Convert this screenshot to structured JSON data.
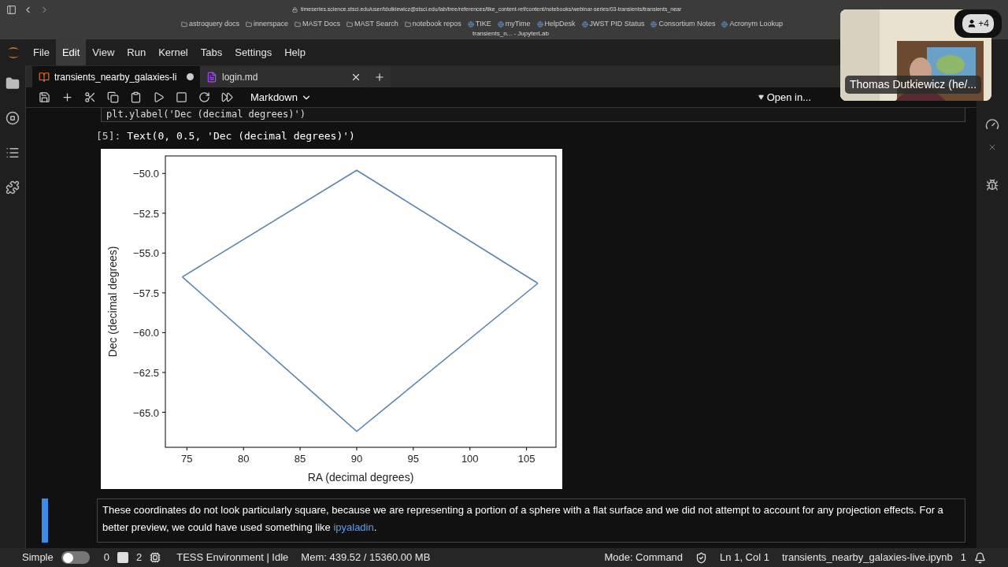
{
  "browser": {
    "url": "timeseries.science.stsci.edu/user/tdutkiewicz@stsci.edu/lab/tree/references/tike_content-ref/content/notebooks/webinar-series/03-transients/transients_near",
    "page_tab": "transients_n... - JupyterLab",
    "bookmarks": [
      {
        "label": "astroquery docs",
        "kind": "folder"
      },
      {
        "label": "innerspace",
        "kind": "folder"
      },
      {
        "label": "MAST Docs",
        "kind": "folder"
      },
      {
        "label": "MAST Search",
        "kind": "folder"
      },
      {
        "label": "notebook repos",
        "kind": "folder"
      },
      {
        "label": "TIKE",
        "kind": "site"
      },
      {
        "label": "myTime",
        "kind": "site"
      },
      {
        "label": "HelpDesk",
        "kind": "site"
      },
      {
        "label": "JWST PID Status",
        "kind": "site"
      },
      {
        "label": "Consortium Notes",
        "kind": "site"
      },
      {
        "label": "Acronym Lookup",
        "kind": "site"
      }
    ]
  },
  "menu": [
    {
      "label": "File",
      "selected": false
    },
    {
      "label": "Edit",
      "selected": true
    },
    {
      "label": "View",
      "selected": false
    },
    {
      "label": "Run",
      "selected": false
    },
    {
      "label": "Kernel",
      "selected": false
    },
    {
      "label": "Tabs",
      "selected": false
    },
    {
      "label": "Settings",
      "selected": false
    },
    {
      "label": "Help",
      "selected": false
    }
  ],
  "tabs": [
    {
      "label": "transients_nearby_galaxies-li",
      "kind": "notebook",
      "selected": true,
      "dirty": true
    },
    {
      "label": "login.md",
      "kind": "markdown",
      "selected": false,
      "dirty": false
    }
  ],
  "toolbar": {
    "cell_type": "Markdown",
    "open_in": "Open in..."
  },
  "code_tail": "plt.ylabel('Dec (decimal degrees)')",
  "output": {
    "prompt": "[5]:",
    "text": "Text(0, 0.5, 'Dec (decimal degrees)')",
    "chart_data": {
      "type": "line",
      "xlabel": "RA (decimal degrees)",
      "ylabel": "Dec (decimal degrees)",
      "x": [
        74.6,
        90,
        106
      ],
      "series": [
        {
          "color": "#5b84ad",
          "values": [
            -56.5,
            -49.8,
            -56.9
          ]
        },
        {
          "color": "#5b84ad",
          "values": [
            -56.5,
            -66.2,
            -56.9
          ]
        }
      ],
      "xlim": [
        73.1,
        107.6
      ],
      "ylim": [
        -67.2,
        -48.9
      ],
      "xticks": [
        75,
        80,
        85,
        90,
        95,
        100,
        105
      ],
      "yticks": [
        {
          "value": -50,
          "label": "−50.0"
        },
        {
          "value": -52.5,
          "label": "−52.5"
        },
        {
          "value": -55,
          "label": "−55.0"
        },
        {
          "value": -57.5,
          "label": "−57.5"
        },
        {
          "value": -60,
          "label": "−60.0"
        },
        {
          "value": -62.5,
          "label": "−62.5"
        },
        {
          "value": -65,
          "label": "−65.0"
        }
      ]
    }
  },
  "markdown": {
    "text": "These coordinates do not look particularly square, because we are representing a portion of a sphere with a flat surface and we did not attempt to account for any projection effects. For a better preview, we could have used something like",
    "link": "ipyaladin",
    "after": "."
  },
  "status": {
    "mode_label": "Simple",
    "simple_on": false,
    "terminals": "0",
    "kernels": "2",
    "kernel": "TESS Environment | Idle",
    "memory": "Mem: 439.52 / 15360.00 MB",
    "mode": "Mode: Command",
    "position": "Ln 1, Col 1",
    "file": "transients_nearby_galaxies-live.ipynb",
    "notifications": "1"
  },
  "video": {
    "name": "Thomas Dutkiewicz (he/...",
    "extra": "+4"
  }
}
